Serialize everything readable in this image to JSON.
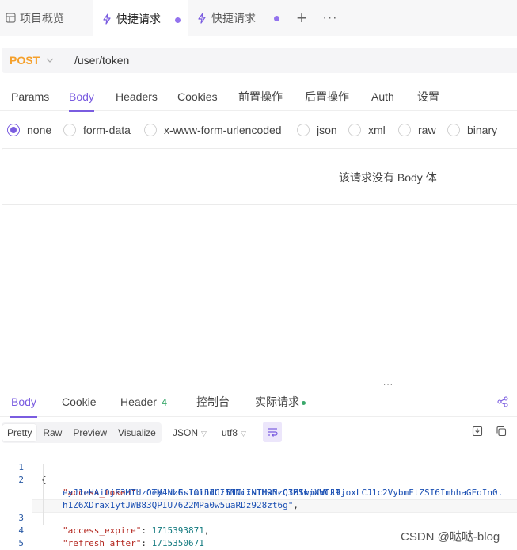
{
  "tabs": [
    {
      "label": "项目概览",
      "icon": "overview-icon"
    },
    {
      "label": "快捷请求",
      "icon": "lightning-icon",
      "active": true,
      "unsaved": true
    },
    {
      "label": "快捷请求",
      "icon": "lightning-icon",
      "unsaved": true
    }
  ],
  "tab_actions": {
    "add": "+",
    "more": "···"
  },
  "request": {
    "method": "POST",
    "url": "/user/token"
  },
  "request_tabs": [
    "Params",
    "Body",
    "Headers",
    "Cookies",
    "前置操作",
    "后置操作",
    "Auth",
    "设置"
  ],
  "active_request_tab": "Body",
  "body_types": [
    "none",
    "form-data",
    "x-www-form-urlencoded",
    "json",
    "xml",
    "raw",
    "binary"
  ],
  "selected_body_type": "none",
  "empty_body_message": "该请求没有 Body 体",
  "response_tabs": [
    {
      "label": "Body",
      "active": true
    },
    {
      "label": "Cookie"
    },
    {
      "label": "Header",
      "count": "4"
    },
    {
      "label": "控制台"
    },
    {
      "label": "实际请求",
      "status_dot": true
    }
  ],
  "response_view": {
    "modes": [
      "Pretty",
      "Raw",
      "Preview",
      "Visualize"
    ],
    "selected_mode": "Pretty",
    "format": "JSON",
    "encoding": "utf8"
  },
  "response_body": {
    "line_numbers": [
      "1",
      "2",
      "",
      "",
      "3",
      "4",
      "5"
    ],
    "open_brace": "{",
    "close_brace": "}",
    "access_token_key": "\"access_token\"",
    "access_token_part1": "\"eyJhbGciOiJIUzI1NiIsInR5cCI6IkpXVCJ9.",
    "access_token_part2": "eyJ1eHAiOjE3MTUzOTM4NzEsImlhdCI6MTcxNTMwNzQ3MSwidWlkIjoxLCJ1c2VybmFtZSI6ImhhaGFoIn0.",
    "access_token_part3": "h1Z6XDrax1ytJWB83QPIU7622MPa0w5uaRDz928zt6g\"",
    "access_expire_key": "\"access_expire\"",
    "access_expire_value": "1715393871",
    "refresh_after_key": "\"refresh_after\"",
    "refresh_after_value": "1715350671"
  },
  "colors": {
    "accent": "#7a5ce0",
    "method_post": "#f5a02b",
    "success": "#3aa86b"
  },
  "watermark": "CSDN @哒哒-blog"
}
